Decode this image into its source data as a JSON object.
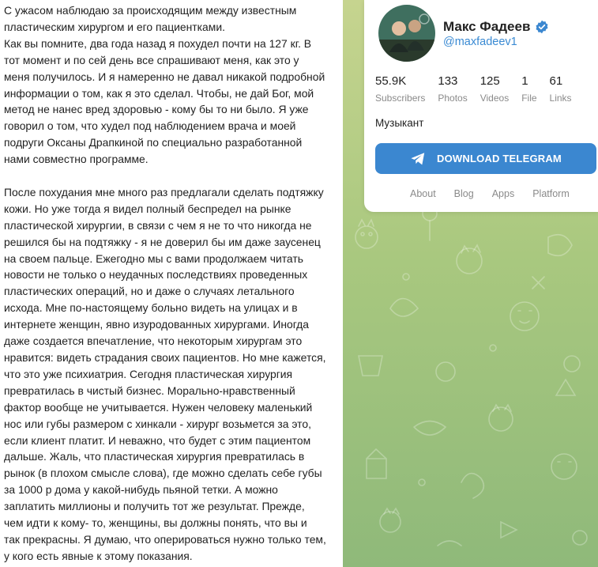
{
  "post": {
    "paragraphs": [
      "С ужасом наблюдаю за происходящим между известным\nпластическим хирургом и его пациентками.\nКак вы помните, два года назад я похудел почти на 127 кг. В\nтот момент и по сей день все спрашивают меня, как это у\nменя получилось. И я намеренно не давал никакой подробной\nинформации о том, как я это сделал. Чтобы, не дай Бог, мой\nметод не нанес вред здоровью - кому бы то ни было. Я уже\nговорил о том, что худел под наблюдением врача и моей\nподруги Оксаны Драпкиной по специально разработанной\nнами совместно программе.",
      "После похудания мне много раз предлагали сделать подтяжку\nкожи. Но уже тогда я видел полный беспредел на рынке\nпластической хирургии, в связи с чем я не то что никогда не\nрешился бы на подтяжку - я не доверил бы им даже заусенец\nна своем пальце. Ежегодно мы с вами продолжаем читать\nновости не только о неудачных последствиях проведенных\nпластических операций, но и даже о случаях летального\nисхода. Мне по-настоящему больно видеть на улицах и в\nинтернете женщин, явно изуродованных хирургами. Иногда\nдаже создается впечатление, что некоторым хирургам это\nнравится: видеть страдания своих пациентов. Но мне кажется,\nчто это уже психиатрия. Сегодня пластическая хирургия\nпревратилась в чистый бизнес. Морально-нравственный\nфактор вообще не учитывается. Нужен человеку маленький\nнос или губы размером с хинкали - хирург возьмется за это,\nесли клиент платит. И неважно, что будет с этим пациентом\nдальше. Жаль, что пластическая хирургия превратилась в\nрынок (в плохом смысле слова), где можно сделать себе губы\nза 1000 р дома у какой-нибудь пьяной тетки. А можно\nзаплатить миллионы и получить тот же результат. Прежде,\nчем идти к кому- то, женщины, вы должны понять, что вы и\nтак прекрасны. Я думаю, что оперироваться нужно только тем,\nу кого есть явные к этому показания."
    ]
  },
  "channel": {
    "name": "Макс Фадеев",
    "username": "@maxfadeev1",
    "description": "Музыкант",
    "verified": true,
    "stats": [
      {
        "value": "55.9K",
        "label": "Subscribers"
      },
      {
        "value": "133",
        "label": "Photos"
      },
      {
        "value": "125",
        "label": "Videos"
      },
      {
        "value": "1",
        "label": "File"
      },
      {
        "value": "61",
        "label": "Links"
      }
    ],
    "download_label": "DOWNLOAD TELEGRAM",
    "footer_links": [
      "About",
      "Blog",
      "Apps",
      "Platform"
    ]
  },
  "colors": {
    "accent": "#3b87d0",
    "username": "#3a8ad3",
    "background_pattern": "#a9c87f"
  },
  "icons": [
    "verified-badge-icon",
    "telegram-plane-icon",
    "doodle-pattern"
  ]
}
